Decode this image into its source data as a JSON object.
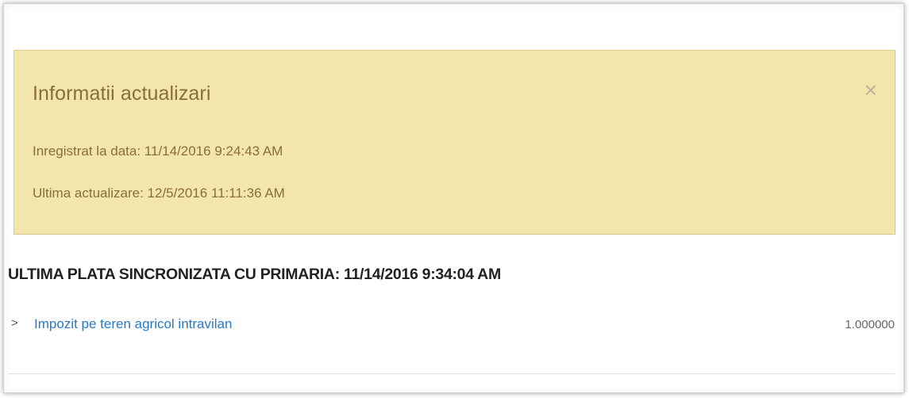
{
  "alert": {
    "title": "Informatii actualizari",
    "close_icon": "×",
    "registered": "Inregistrat la data: 11/14/2016 9:24:43 AM",
    "last_update": "Ultima actualizare: 12/5/2016 11:11:36 AM"
  },
  "section": {
    "title": "ULTIMA PLATA SINCRONIZATA CU PRIMARIA: 11/14/2016 9:34:04 AM"
  },
  "items": [
    {
      "chevron": ">",
      "label": "Impozit pe teren agricol intravilan",
      "value": "1.000000"
    }
  ],
  "colors": {
    "alert_bg": "#f2e6ab",
    "alert_text": "#8a6d3b",
    "link": "#2a78c2"
  }
}
